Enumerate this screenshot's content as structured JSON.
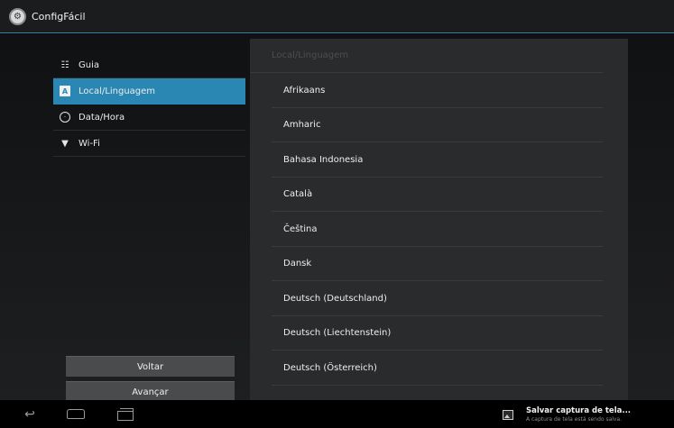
{
  "app": {
    "title": "ConfigFácil",
    "icon": "settings-app-icon"
  },
  "nav": {
    "items": [
      {
        "label": "Guia",
        "icon": "tune-sliders-icon",
        "active": false
      },
      {
        "label": "Local/Linguagem",
        "icon": "language-a-icon",
        "active": true
      },
      {
        "label": "Data/Hora",
        "icon": "clock-icon",
        "active": false
      },
      {
        "label": "Wi-Fi",
        "icon": "wifi-icon",
        "active": false
      }
    ]
  },
  "buttons": {
    "back": "Voltar",
    "next": "Avançar"
  },
  "language_list": {
    "header": "Local/Linguagem",
    "items": [
      "Afrikaans",
      "Amharic",
      "Bahasa Indonesia",
      "Català",
      "Čeština",
      "Dansk",
      "Deutsch (Deutschland)",
      "Deutsch (Liechtenstein)",
      "Deutsch (Österreich)"
    ]
  },
  "notification": {
    "icon": "image-icon",
    "title": "Salvar captura de tela...",
    "subtitle": "A captura de tela está sendo salva."
  },
  "system_nav": {
    "back": "back-icon",
    "home": "home-icon",
    "recents": "recents-icon"
  },
  "colors": {
    "accent": "#2a87b3",
    "panel": "#2a2b2c",
    "actionbar": "#1b1c1d"
  }
}
